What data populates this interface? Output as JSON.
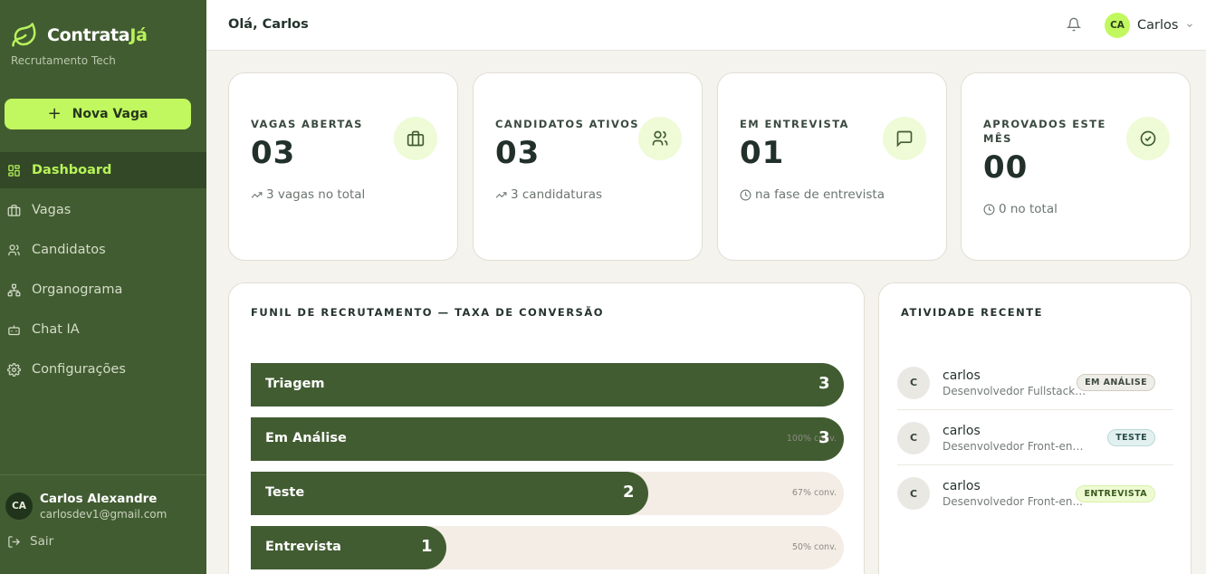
{
  "brand": {
    "name_main": "Contrata",
    "name_accent": "Já",
    "tagline": "Recrutamento Tech",
    "accent_color": "#b8f35a",
    "sidebar_color": "#425c32"
  },
  "sidebar": {
    "new_button": "Nova Vaga",
    "items": [
      {
        "label": "Dashboard",
        "icon": "grid-icon",
        "active": true
      },
      {
        "label": "Vagas",
        "icon": "briefcase-icon"
      },
      {
        "label": "Candidatos",
        "icon": "users-icon"
      },
      {
        "label": "Organograma",
        "icon": "org-chart-icon"
      },
      {
        "label": "Chat IA",
        "icon": "bot-icon"
      },
      {
        "label": "Configurações",
        "icon": "gear-icon"
      }
    ],
    "user": {
      "initials": "CA",
      "name": "Carlos Alexandre",
      "email": "carlosdev1@gmail.com"
    },
    "logout": "Sair"
  },
  "header": {
    "greeting": "Olá, Carlos",
    "user_initials": "CA",
    "user_name": "Carlos"
  },
  "stats": [
    {
      "label": "VAGAS ABERTAS",
      "value": "03",
      "sub": "3 vagas no total",
      "sub_icon": "trend-up-icon",
      "icon": "briefcase-icon"
    },
    {
      "label": "CANDIDATOS ATIVOS",
      "value": "03",
      "sub": "3 candidaturas",
      "sub_icon": "trend-up-icon",
      "icon": "users-icon"
    },
    {
      "label": "EM ENTREVISTA",
      "value": "01",
      "sub": "na fase de entrevista",
      "sub_icon": "clock-icon",
      "icon": "chat-icon"
    },
    {
      "label": "APROVADOS ESTE MÊS",
      "value": "00",
      "sub": "0 no total",
      "sub_icon": "clock-icon",
      "icon": "check-circle-icon"
    }
  ],
  "funnel": {
    "title": "FUNIL DE RECRUTAMENTO — TAXA DE CONVERSÃO",
    "stages": [
      {
        "label": "Triagem",
        "count": "3",
        "fill": 1.0,
        "conv": ""
      },
      {
        "label": "Em Análise",
        "count": "3",
        "fill": 1.0,
        "conv": "100% conv."
      },
      {
        "label": "Teste",
        "count": "2",
        "fill": 0.67,
        "conv": "67% conv."
      },
      {
        "label": "Entrevista",
        "count": "1",
        "fill": 0.33,
        "conv": "50% conv."
      }
    ]
  },
  "activity": {
    "title": "ATIVIDADE RECENTE",
    "items": [
      {
        "initial": "C",
        "name": "carlos",
        "role": "Desenvolvedor Fullstack ...",
        "status": "EM ANÁLISE"
      },
      {
        "initial": "C",
        "name": "carlos",
        "role": "Desenvolvedor Front-end Júni...",
        "status": "TESTE"
      },
      {
        "initial": "C",
        "name": "carlos",
        "role": "Desenvolvedor Front-en...",
        "status": "ENTREVISTA"
      }
    ]
  }
}
